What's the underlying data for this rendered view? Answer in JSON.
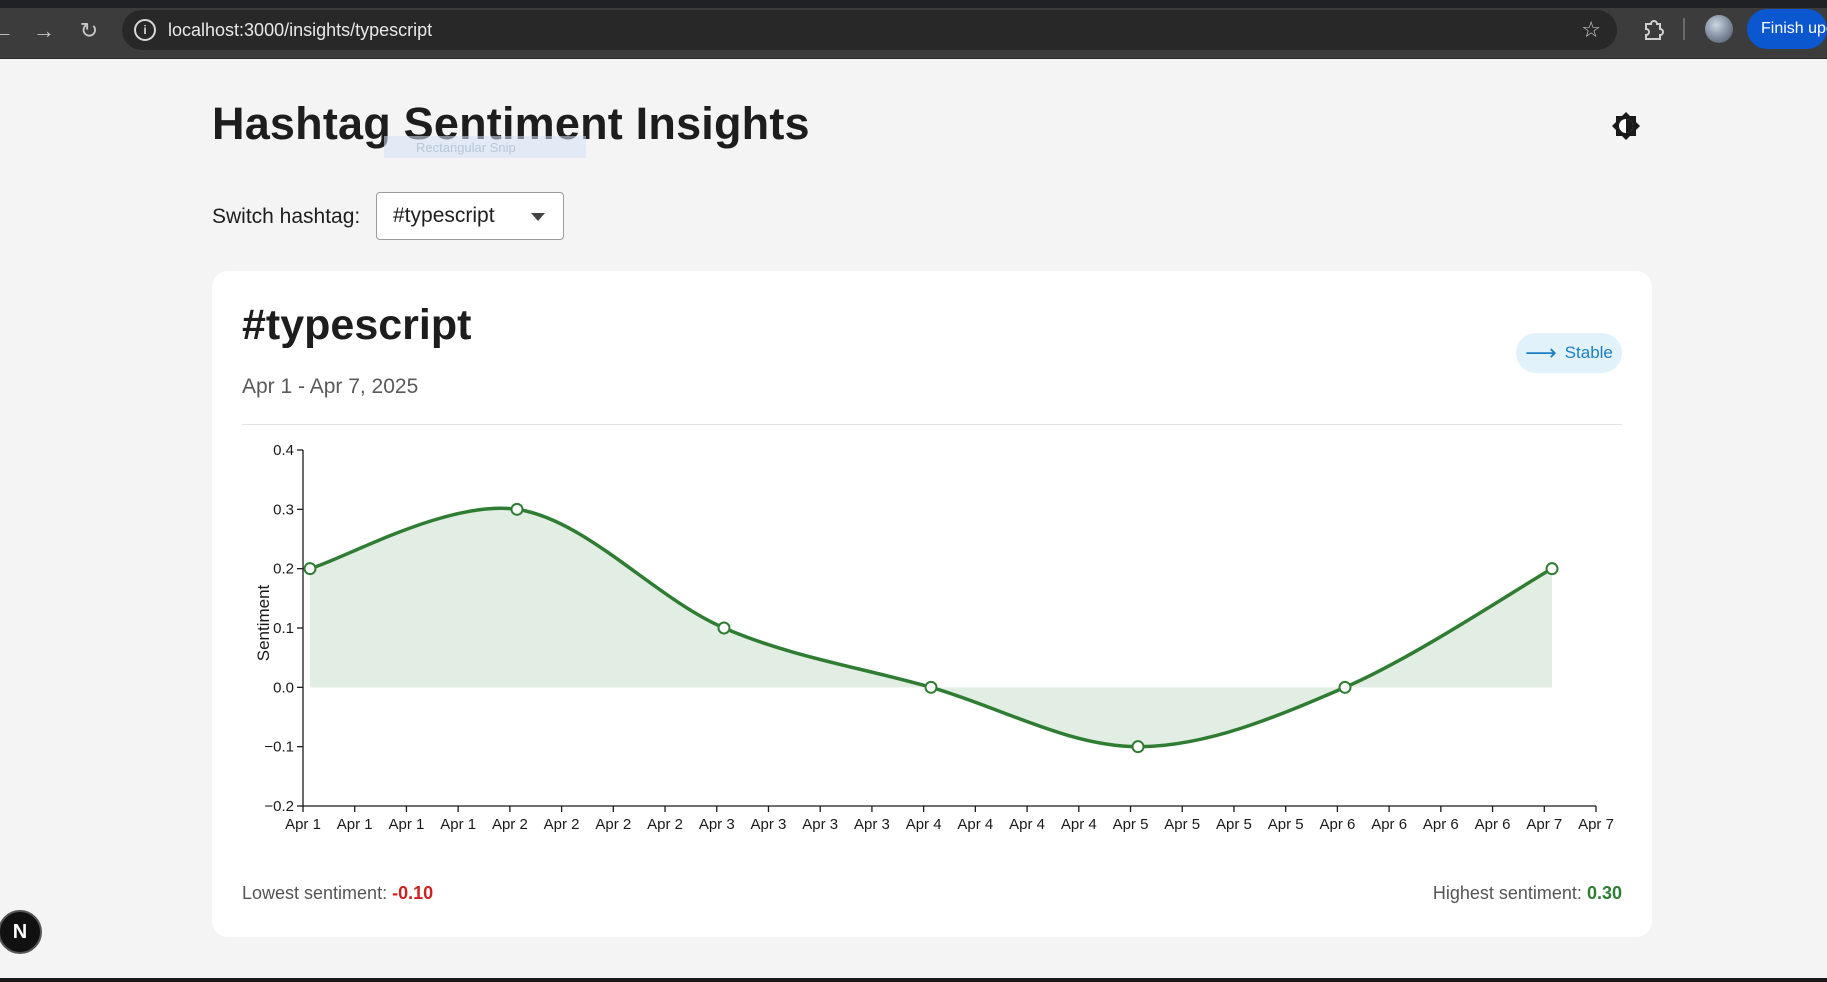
{
  "browser": {
    "url": "localhost:3000/insights/typescript",
    "update_label": "Finish update",
    "back_icon": "back-arrow-icon",
    "forward_icon": "forward-arrow-icon",
    "reload_icon": "reload-icon"
  },
  "header": {
    "title": "Hashtag Sentiment Insights",
    "ghost_tooltip": "Rectangular Snip"
  },
  "switcher": {
    "label": "Switch hashtag:",
    "selected": "#typescript"
  },
  "card": {
    "hashtag": "#typescript",
    "date_range": "Apr 1 - Apr 7, 2025",
    "trend_label": "Stable",
    "trend_color": "#1c7fc4",
    "lowest_label": "Lowest sentiment:",
    "lowest_value": "-0.10",
    "highest_label": "Highest sentiment:",
    "highest_value": "0.30"
  },
  "chart_data": {
    "type": "area",
    "title": "",
    "xlabel": "",
    "ylabel": "Sentiment",
    "x": [
      "2025-04-01",
      "2025-04-02",
      "2025-04-03",
      "2025-04-04",
      "2025-04-05",
      "2025-04-06",
      "2025-04-07"
    ],
    "values": [
      0.2,
      0.3,
      0.1,
      0.0,
      -0.1,
      0.0,
      0.2
    ],
    "ylim": [
      -0.2,
      0.4
    ],
    "y_ticks": [
      "−0.2",
      "−0.1",
      "0.0",
      "0.1",
      "0.2",
      "0.3",
      "0.4"
    ],
    "x_tick_labels": [
      "Apr 1",
      "Apr 1",
      "Apr 1",
      "Apr 1",
      "Apr 2",
      "Apr 2",
      "Apr 2",
      "Apr 2",
      "Apr 3",
      "Apr 3",
      "Apr 3",
      "Apr 3",
      "Apr 4",
      "Apr 4",
      "Apr 4",
      "Apr 4",
      "Apr 5",
      "Apr 5",
      "Apr 5",
      "Apr 5",
      "Apr 6",
      "Apr 6",
      "Apr 6",
      "Apr 6",
      "Apr 7",
      "Apr 7"
    ],
    "line_color": "#2e7d32",
    "fill_color": "#e2eee3",
    "grid": false,
    "legend": "none"
  },
  "dev_badge": "N"
}
